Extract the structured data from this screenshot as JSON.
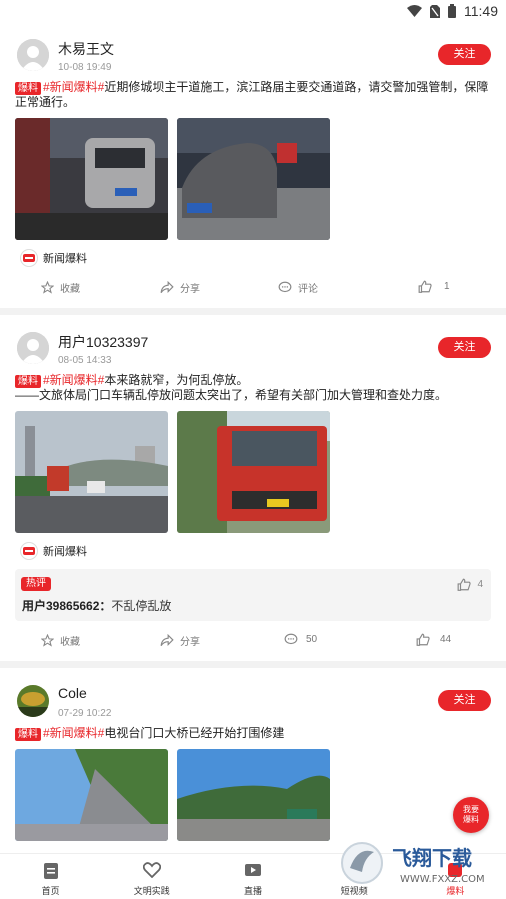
{
  "status_bar": {
    "time": "11:49"
  },
  "posts": [
    {
      "author": "木易王文",
      "time": "10-08 19:49",
      "follow_label": "关注",
      "badge": "爆料",
      "topic": "#新闻爆料#",
      "text": "近期修城坝主干道施工，滨江路届主要交通道路，请交警加强管制，保障正常通行。",
      "source": "新闻爆料",
      "actions": {
        "collect": "收藏",
        "share": "分享",
        "comment": "评论",
        "likes": "1"
      }
    },
    {
      "author": "用户10323397",
      "time": "08-05 14:33",
      "follow_label": "关注",
      "badge": "爆料",
      "topic": "#新闻爆料#",
      "text": "本来路就窄，为何乱停放。",
      "text2": "——文旅体局门口车辆乱停放问题太突出了，希望有关部门加大管理和查处力度。",
      "source": "新闻爆料",
      "hot_comment": {
        "badge": "热评",
        "user": "用户39865662：",
        "text": "不乱停乱放",
        "likes": "4"
      },
      "actions": {
        "collect": "收藏",
        "share": "分享",
        "comment": "50",
        "likes": "44"
      }
    },
    {
      "author": "Cole",
      "time": "07-29 10:22",
      "follow_label": "关注",
      "badge": "爆料",
      "topic": "#新闻爆料#",
      "text": "电视台门口大桥已经开始打围修建"
    }
  ],
  "float_button": {
    "line1": "我要",
    "line2": "爆料"
  },
  "tabbar": [
    {
      "label": "首页",
      "icon": "home-icon"
    },
    {
      "label": "文明实践",
      "icon": "heart-icon"
    },
    {
      "label": "直播",
      "icon": "video-icon"
    },
    {
      "label": "短视频",
      "icon": "short-video-icon"
    },
    {
      "label": "爆料",
      "icon": "report-icon"
    }
  ],
  "watermark": {
    "title": "飞翔下载",
    "url": "WWW.FXXZ.COM"
  }
}
